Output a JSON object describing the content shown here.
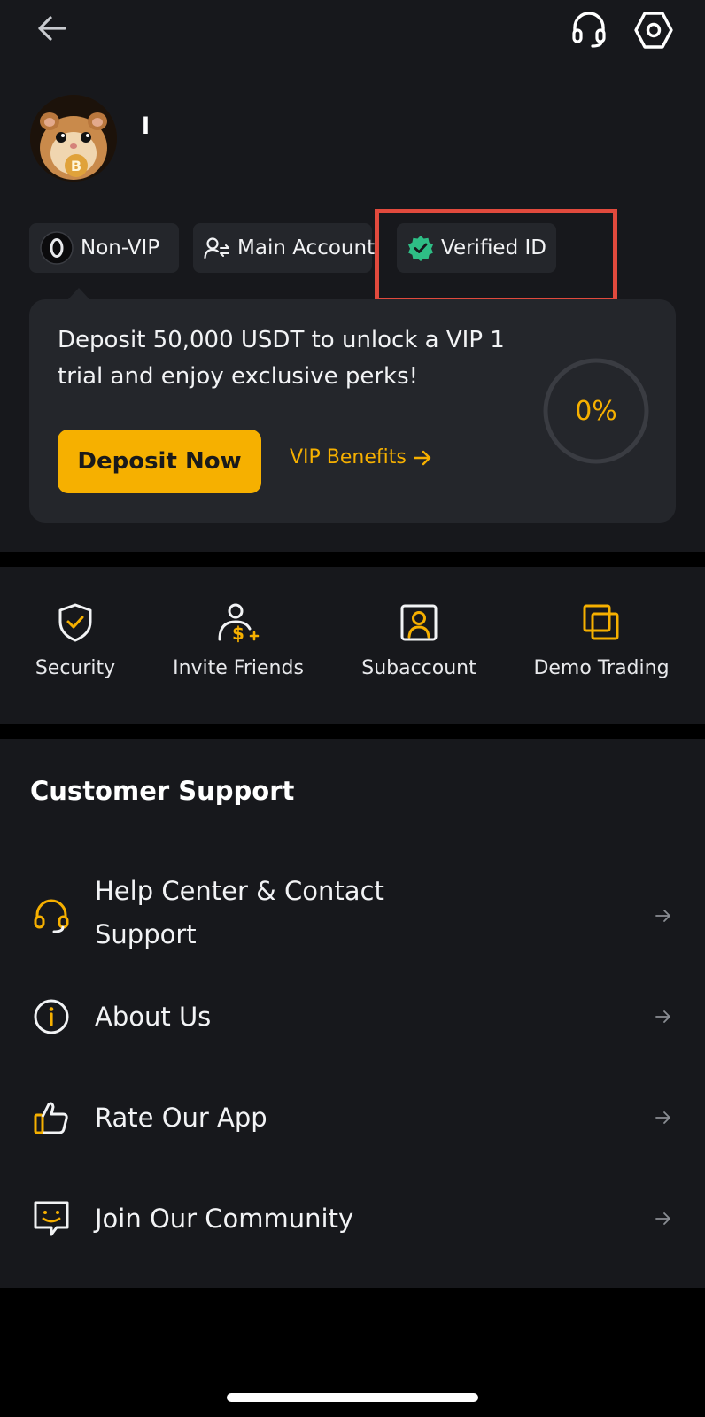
{
  "header": {
    "back_icon": "arrow-left-icon",
    "support_icon": "headset-icon",
    "settings_icon": "hexagon-gear-icon"
  },
  "profile": {
    "username": "l",
    "avatar": "hamster-bitcoin-avatar"
  },
  "tags": {
    "vip_label": "Non-VIP",
    "vip_icon": "vip-0-badge-icon",
    "account_label": "Main Account",
    "account_icon": "user-switch-icon",
    "verified_label": "Verified ID",
    "verified_icon": "verified-check-badge-icon"
  },
  "vip_card": {
    "promo_text": "Deposit 50,000 USDT to unlock a VIP 1 trial and enjoy exclusive perks!",
    "deposit_button": "Deposit Now",
    "benefits_link": "VIP Benefits",
    "progress_text": "0%",
    "progress_fraction": 0
  },
  "shortcuts": [
    {
      "label": "Security",
      "icon": "shield-check-icon"
    },
    {
      "label": "Invite Friends",
      "icon": "user-dollar-icon"
    },
    {
      "label": "Subaccount",
      "icon": "user-square-icon"
    },
    {
      "label": "Demo Trading",
      "icon": "stacked-squares-icon"
    }
  ],
  "support": {
    "title": "Customer Support",
    "items": [
      {
        "label": "Help Center & Contact Support",
        "icon": "headset-icon"
      },
      {
        "label": "About Us",
        "icon": "info-circle-icon"
      },
      {
        "label": "Rate Our App",
        "icon": "thumbs-up-icon"
      },
      {
        "label": "Join Our Community",
        "icon": "chat-smile-icon"
      }
    ]
  },
  "colors": {
    "accent": "#f6b000",
    "background": "#17181c",
    "card": "#24262b",
    "verified_green": "#2ebd85",
    "highlight_red": "#e14a3d"
  }
}
